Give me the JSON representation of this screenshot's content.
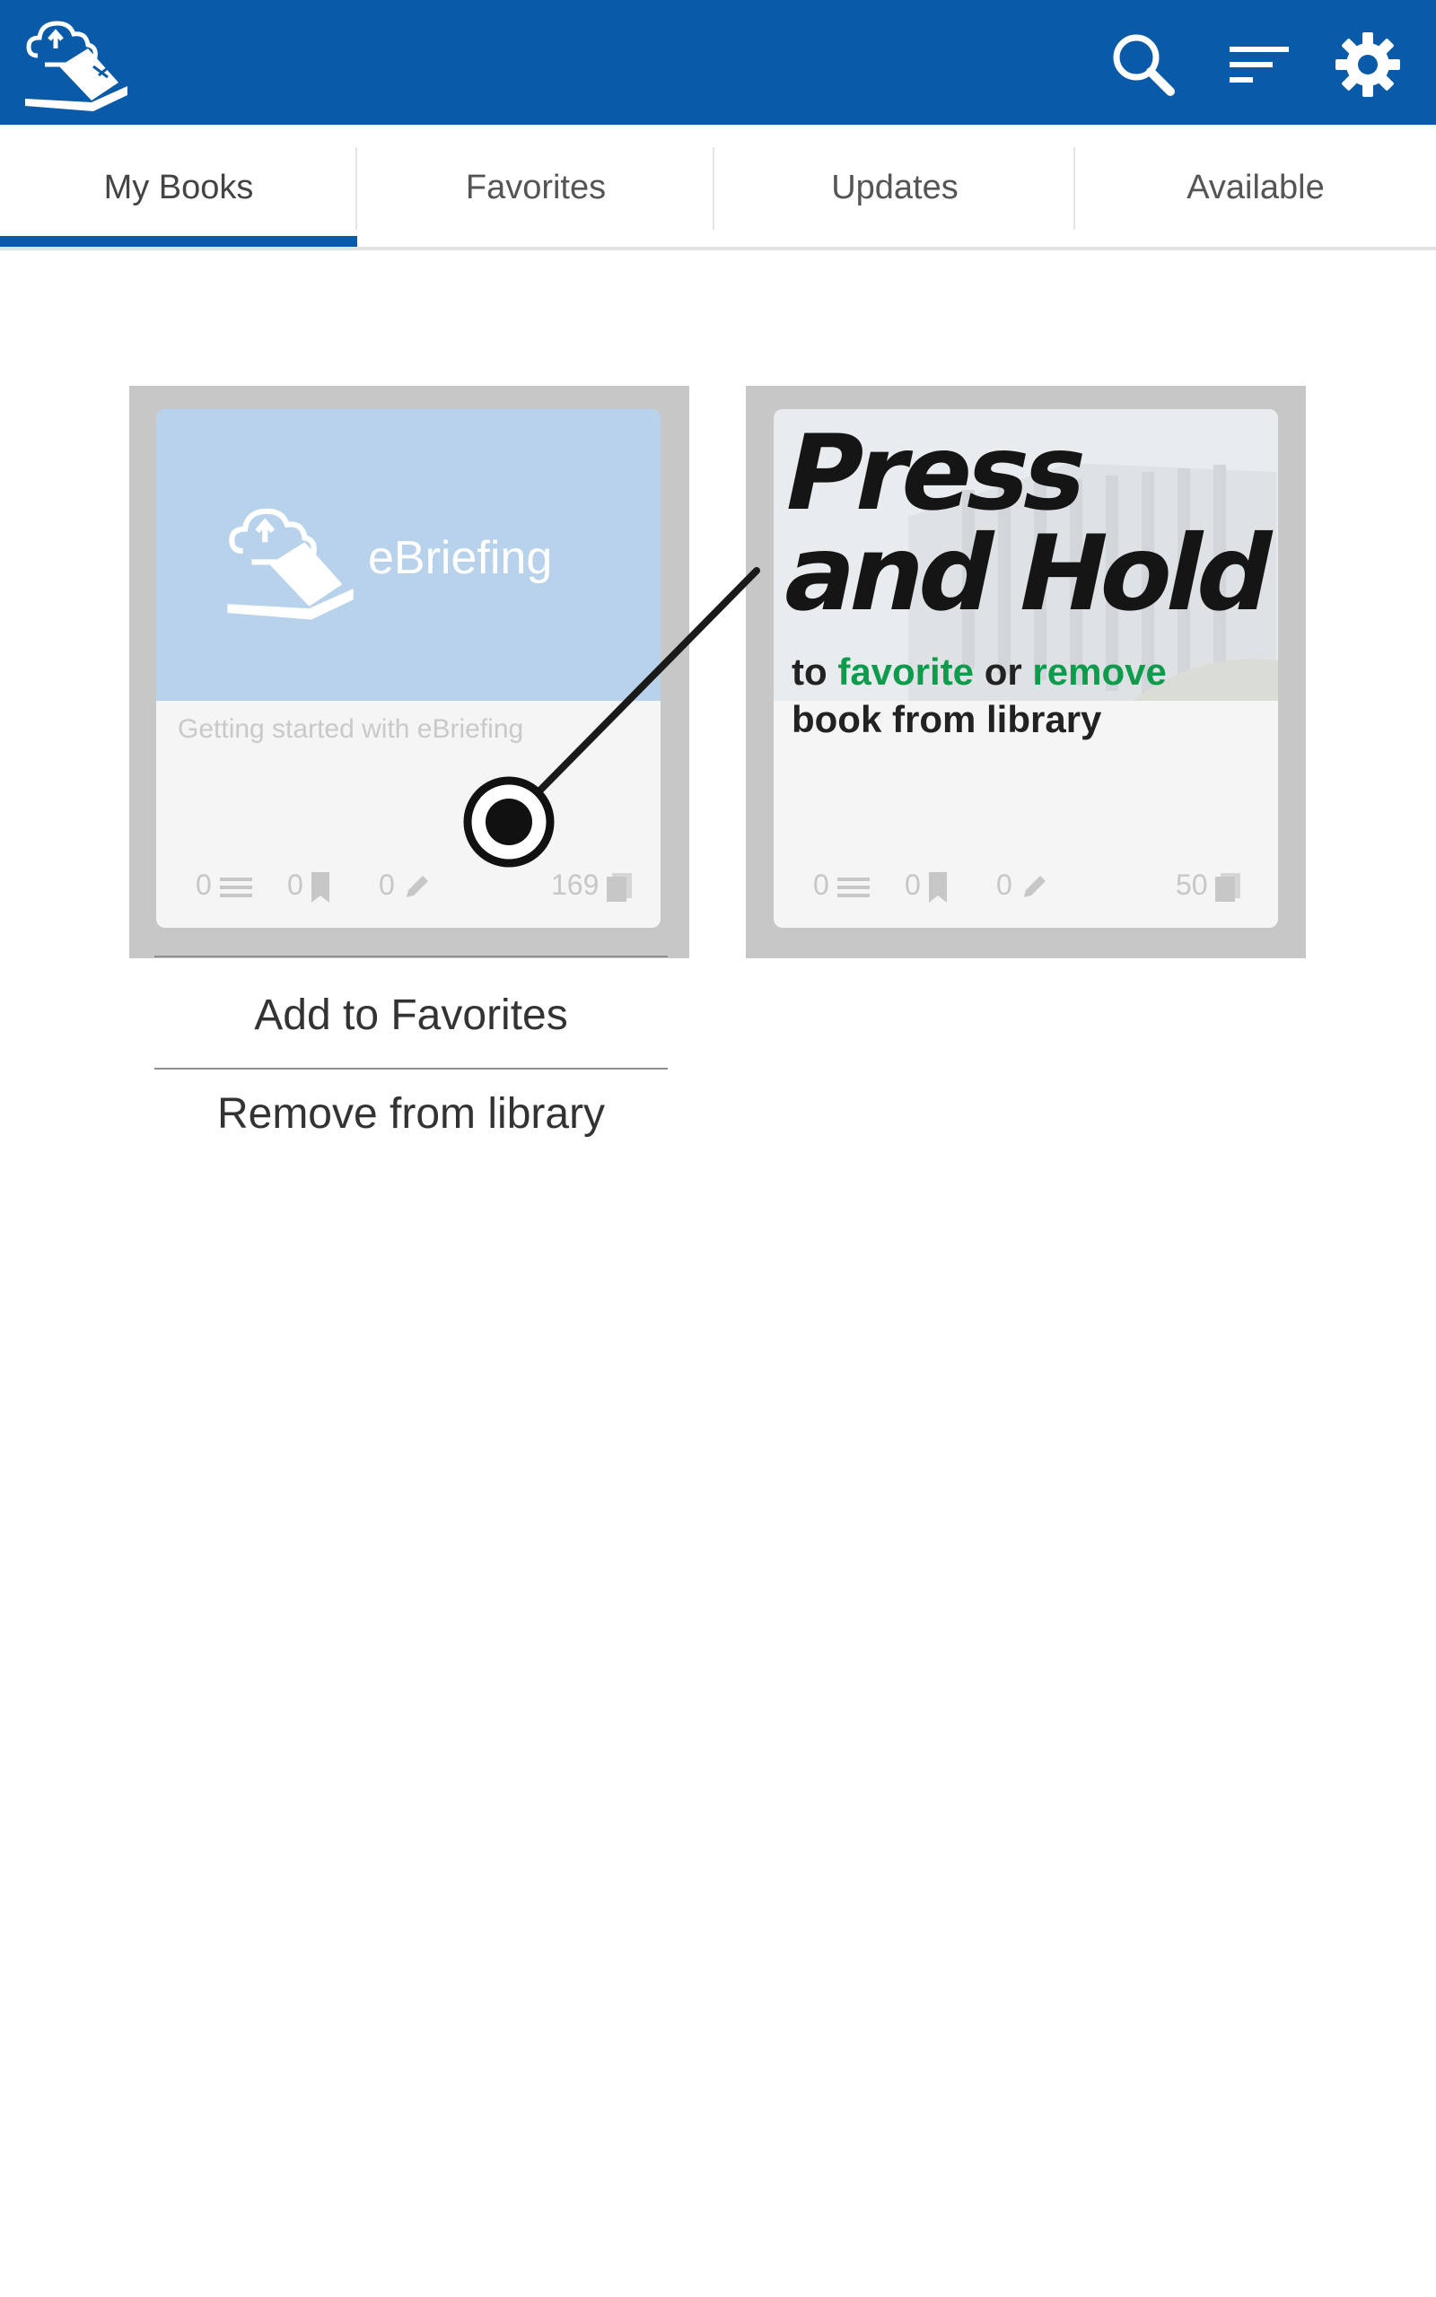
{
  "header": {
    "logo_icon": "ebriefing-cloud-book-icon",
    "actions": [
      "search-icon",
      "sort-icon",
      "gear-icon"
    ],
    "bar_color": "#0a5aaa"
  },
  "tabs": [
    {
      "label": "My Books",
      "active": true
    },
    {
      "label": "Favorites",
      "active": false
    },
    {
      "label": "Updates",
      "active": false
    },
    {
      "label": "Available",
      "active": false
    }
  ],
  "books": [
    {
      "cover_title": "eBriefing",
      "subtitle": "Getting started with eBriefing",
      "chapters": "0",
      "bookmarks": "0",
      "notes": "0",
      "pages": "169"
    },
    {
      "cover_title": "",
      "subtitle": "",
      "chapters": "0",
      "bookmarks": "0",
      "notes": "0",
      "pages": "50"
    }
  ],
  "context_menu": {
    "add_favorites": "Add to Favorites",
    "remove_library": "Remove from library"
  },
  "hint": {
    "line1": "Press",
    "line2": "and Hold",
    "sub_to": "to",
    "sub_favorite": "favorite",
    "sub_or": "or",
    "sub_remove": "remove",
    "sub_line2": "book from library",
    "accent_color": "#0e9b4c"
  }
}
